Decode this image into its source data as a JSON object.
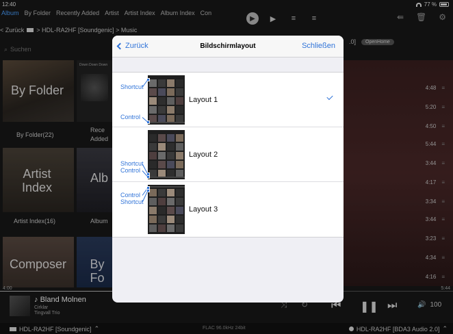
{
  "status_bar": {
    "time": "12:40",
    "battery": "77 %"
  },
  "category_tabs": [
    "Album",
    "By Folder",
    "Recently Added",
    "Artist",
    "Artist Index",
    "Album Index",
    "Con"
  ],
  "breadcrumb": {
    "back": "< Zurück",
    "path": "> HDL-RA2HF [Soundgenic] > Music"
  },
  "status_text": ".0]",
  "status_pill": "OpenHome",
  "search": {
    "placeholder": "Suchen"
  },
  "tiles": [
    {
      "caption": "By Folder",
      "label": "By Folder(22)"
    },
    {
      "caption": "",
      "label": "Rece\nAdded"
    },
    {
      "caption": "Artist\nIndex",
      "label": "Artist Index(16)"
    },
    {
      "caption": "Alb",
      "label": "Album"
    },
    {
      "caption": "Composer",
      "label": ""
    },
    {
      "caption": "By Fo",
      "label": ""
    }
  ],
  "tile_small_text": "Down Down Down",
  "durations": [
    "4:48",
    "5:20",
    "4:50",
    "5:44",
    "3:44",
    "4:17",
    "3:34",
    "3:44",
    "3:23",
    "4:34",
    "4:16"
  ],
  "player": {
    "elapsed": "4:00",
    "total": "5:44",
    "progress_fraction": 0.69,
    "track": "Bland Molnen",
    "album": "Cirklar",
    "artist": "Tingvall Trio",
    "volume": "100"
  },
  "bottom_bar": {
    "source": "HDL-RA2HF [Soundgenic]",
    "format": "FLAC 96.0kHz 24bit",
    "renderer": "HDL-RA2HF [BDA3 Audio 2.0]"
  },
  "modal": {
    "back": "Zurück",
    "title": "Bildschirmlayout",
    "close": "Schließen",
    "options": [
      {
        "label": "Layout 1",
        "selected": true,
        "annotations": [
          "Shortcut",
          "Control"
        ]
      },
      {
        "label": "Layout 2",
        "selected": false,
        "annotations": [
          "Shortcut",
          "Control"
        ]
      },
      {
        "label": "Layout 3",
        "selected": false,
        "annotations": [
          "Control",
          "Shortcut"
        ]
      }
    ]
  }
}
